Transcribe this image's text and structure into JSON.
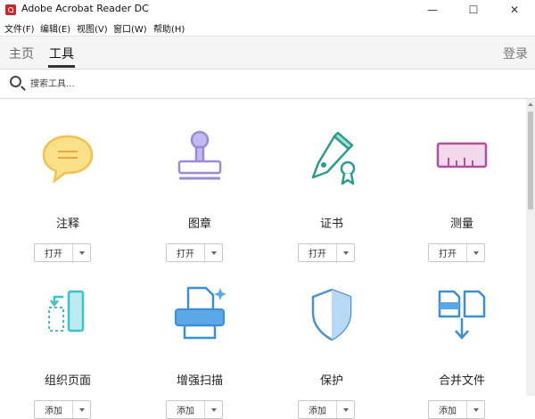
{
  "window": {
    "title": "Adobe Acrobat Reader DC",
    "controls": {
      "minimize": "—",
      "maximize": "☐",
      "close": "✕"
    }
  },
  "menu": [
    "文件(F)",
    "编辑(E)",
    "视图(V)",
    "窗口(W)",
    "帮助(H)"
  ],
  "tabs": [
    {
      "label": "主页",
      "active": false
    },
    {
      "label": "工具",
      "active": true
    }
  ],
  "signin": "登录",
  "search": {
    "placeholder": "搜索工具..."
  },
  "tools": [
    {
      "name": "注释",
      "action": "打开",
      "icon": "comment-icon",
      "color": "#f2c14e"
    },
    {
      "name": "图章",
      "action": "打开",
      "icon": "stamp-icon",
      "color": "#9b8bd6"
    },
    {
      "name": "证书",
      "action": "打开",
      "icon": "certificate-icon",
      "color": "#2a9d8f"
    },
    {
      "name": "测量",
      "action": "打开",
      "icon": "ruler-icon",
      "color": "#b24fa0"
    },
    {
      "name": "组织页面",
      "action": "添加",
      "icon": "organize-pages-icon",
      "color": "#3fc1c9"
    },
    {
      "name": "增强扫描",
      "action": "添加",
      "icon": "scan-icon",
      "color": "#3b8fd6"
    },
    {
      "name": "保护",
      "action": "添加",
      "icon": "shield-icon",
      "color": "#4a90d9"
    },
    {
      "name": "合并文件",
      "action": "添加",
      "icon": "combine-files-icon",
      "color": "#3b8fd6"
    }
  ]
}
